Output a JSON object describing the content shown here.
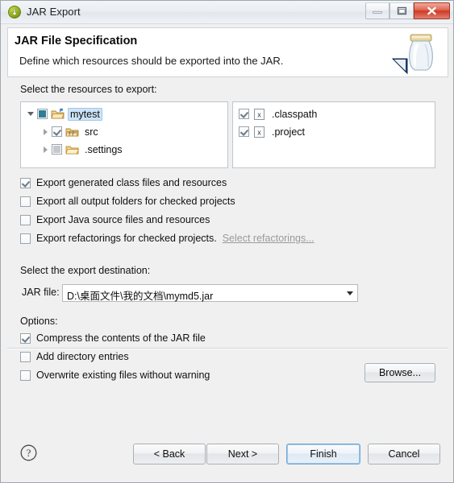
{
  "window": {
    "title": "JAR Export",
    "title_icon": "jar-export-icon",
    "controls": {
      "minimize": "minimize-icon",
      "maximize": "maximize-icon",
      "close": "close-icon"
    }
  },
  "header": {
    "title": "JAR File Specification",
    "description": "Define which resources should be exported into the JAR.",
    "art_icon": "jar-jar-icon"
  },
  "resources": {
    "label": "Select the resources to export:",
    "tree": [
      {
        "label": "mytest",
        "icon": "java-project-icon",
        "check": "grayed-blue",
        "twisty": "expanded",
        "indent": 0,
        "selected": true
      },
      {
        "label": "src",
        "icon": "source-folder-icon",
        "check": "checked",
        "twisty": "collapsed",
        "indent": 1,
        "selected": false
      },
      {
        "label": ".settings",
        "icon": "folder-icon",
        "check": "grayed-gray",
        "twisty": "collapsed",
        "indent": 1,
        "selected": false
      }
    ],
    "files": [
      {
        "label": ".classpath",
        "icon": "xml-file-icon",
        "check": "checked"
      },
      {
        "label": ".project",
        "icon": "xml-file-icon",
        "check": "checked"
      }
    ]
  },
  "export_options": [
    {
      "label": "Export generated class files and resources",
      "check": "checked",
      "link": null
    },
    {
      "label": "Export all output folders for checked projects",
      "check": "unchecked",
      "link": null
    },
    {
      "label": "Export Java source files and resources",
      "check": "unchecked",
      "link": null
    },
    {
      "label": "Export refactorings for checked projects.",
      "check": "unchecked",
      "link": "Select refactorings..."
    }
  ],
  "destination": {
    "label": "Select the export destination:",
    "jarfile_label": "JAR file:",
    "jarfile_value": "D:\\桌面文件\\我的文档\\mymd5.jar",
    "browse_label": "Browse..."
  },
  "options": {
    "label": "Options:",
    "items": [
      {
        "label": "Compress the contents of the JAR file",
        "check": "checked"
      },
      {
        "label": "Add directory entries",
        "check": "unchecked"
      },
      {
        "label": "Overwrite existing files without warning",
        "check": "unchecked"
      }
    ]
  },
  "buttons": {
    "help": "help-icon",
    "back": "< Back",
    "next": "Next >",
    "finish": "Finish",
    "cancel": "Cancel"
  },
  "colors": {
    "accent": "#cde4f7",
    "close_button": "#cf3a26",
    "focus_ring": "#6fa8d6",
    "grayed_check": "#2e7e96"
  }
}
